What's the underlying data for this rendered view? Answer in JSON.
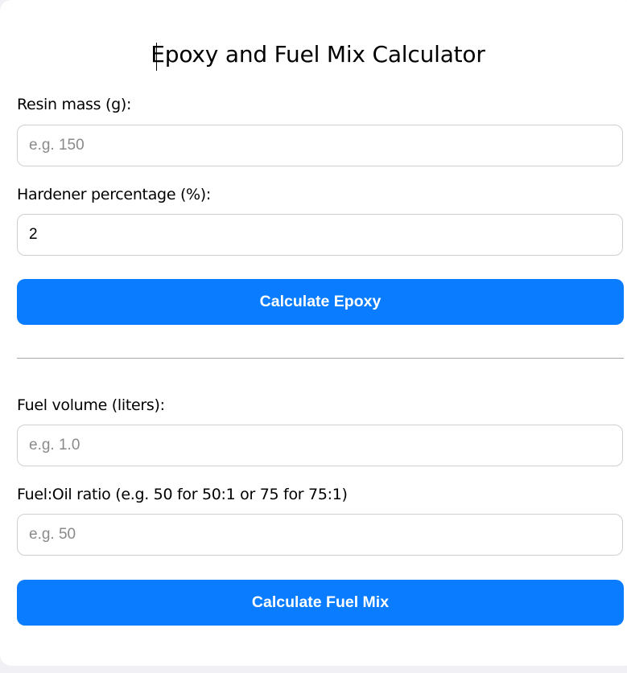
{
  "title": "Epoxy and Fuel Mix Calculator",
  "epoxy": {
    "resin_label": "Resin mass (g):",
    "resin_value": "",
    "resin_placeholder": "e.g. 150",
    "hardener_label": "Hardener percentage (%):",
    "hardener_value": "2",
    "hardener_placeholder": "",
    "button_label": "Calculate Epoxy"
  },
  "fuel": {
    "volume_label": "Fuel volume (liters):",
    "volume_value": "",
    "volume_placeholder": "e.g. 1.0",
    "ratio_label": "Fuel:Oil ratio (e.g. 50 for 50:1 or 75 for 75:1)",
    "ratio_value": "",
    "ratio_placeholder": "e.g. 50",
    "button_label": "Calculate Fuel Mix"
  },
  "colors": {
    "accent": "#0a7cff",
    "background": "#f0f0f5",
    "card": "#ffffff"
  }
}
